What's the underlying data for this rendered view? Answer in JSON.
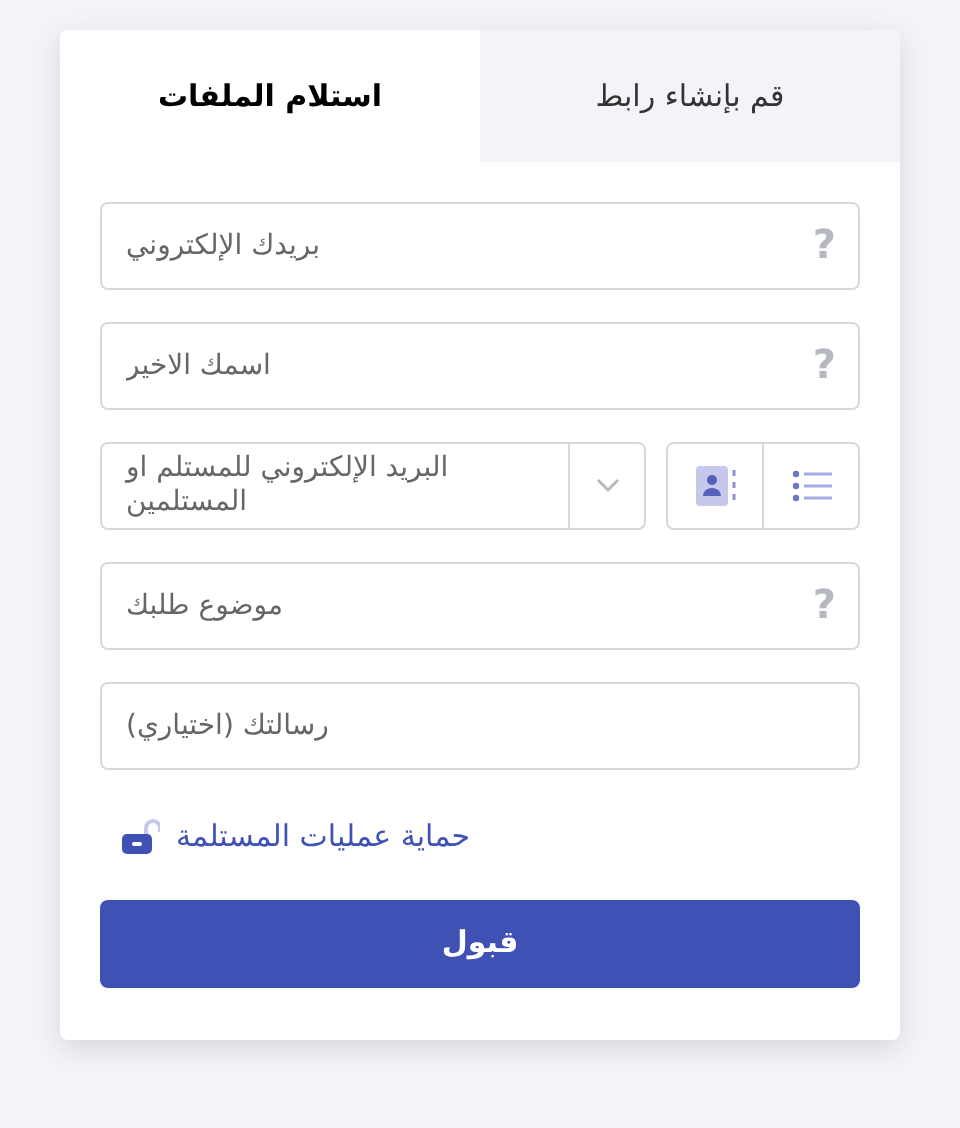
{
  "tabs": [
    {
      "label": "قم بإنشاء رابط",
      "selected": false
    },
    {
      "label": "استلام الملفات",
      "selected": true
    }
  ],
  "fields": [
    {
      "kind": "input",
      "placeholder": "بريدك الإلكتروني",
      "help": "?"
    },
    {
      "kind": "input",
      "placeholder": "اسمك الاخير",
      "help": "?"
    },
    {
      "kind": "recipients",
      "placeholder": "البريد الإلكتروني للمستلم او المستلمين"
    },
    {
      "kind": "input",
      "placeholder": "موضوع طلبك",
      "help": "?"
    },
    {
      "kind": "input",
      "placeholder": "رسالتك (اختياري)"
    }
  ],
  "protection_link": "حماية عمليات المستلمة",
  "submit": "قبول"
}
